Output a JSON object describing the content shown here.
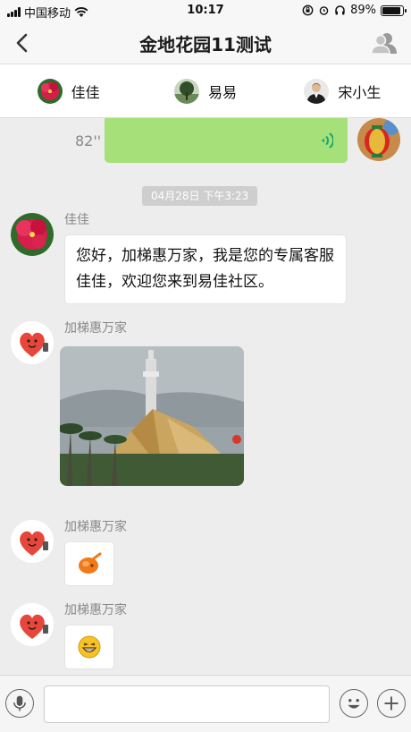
{
  "status_bar": {
    "carrier": "中国移动",
    "time": "10:17",
    "battery": "89%",
    "battery_level": 0.89,
    "icons": [
      "signal-icon",
      "wifi-icon",
      "rotation-lock-icon",
      "alarm-icon",
      "headphones-icon",
      "battery-icon"
    ]
  },
  "header": {
    "title": "金地花园11测试",
    "back_icon": "back-chevron-icon",
    "group_icon": "group-members-icon"
  },
  "members": [
    {
      "name": "佳佳",
      "avatar": "hibiscus-avatar"
    },
    {
      "name": "易易",
      "avatar": "tree-avatar"
    },
    {
      "name": "宋小生",
      "avatar": "person-avatar"
    }
  ],
  "chat": {
    "voice_message": {
      "duration": "82''",
      "icon": "voice-wave-icon"
    },
    "timestamp": "04月28日 下午3:23",
    "messages": [
      {
        "sender": "佳佳",
        "type": "text",
        "text": "您好，加梯惠万家，我是您的专属客服佳佳，欢迎您来到易佳社区。"
      },
      {
        "sender": "加梯惠万家",
        "type": "image",
        "image": "tower-photo"
      },
      {
        "sender": "加梯惠万家",
        "type": "emoji",
        "emoji": "orange-sticker-icon"
      },
      {
        "sender": "加梯惠万家",
        "type": "emoji",
        "emoji": "grin-emoji-icon"
      }
    ]
  },
  "input_bar": {
    "placeholder": "",
    "voice_icon": "microphone-icon",
    "emoji_icon": "smiley-icon",
    "plus_icon": "plus-icon"
  }
}
